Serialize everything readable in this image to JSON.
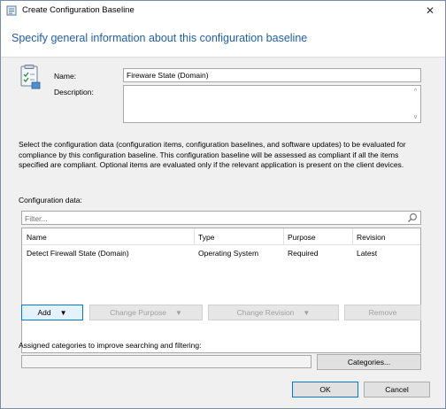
{
  "window": {
    "title": "Create Configuration Baseline",
    "close_glyph": "✕"
  },
  "heading": "Specify general information about this configuration baseline",
  "form": {
    "name_label": "Name:",
    "name_value": "Fireware State (Domain)",
    "description_label": "Description:",
    "description_value": ""
  },
  "instructions": [
    "Select the configuration data (configuration items, configuration baselines, and software updates) to be evaluated for",
    "compliance by this configuration baseline. This configuration baseline will be assessed as compliant if all the items",
    "specified are compliant. Optional items are evaluated only if the relevant application is present on  the client devices."
  ],
  "config_data": {
    "label": "Configuration data:",
    "filter_placeholder": "Filter...",
    "columns": [
      "Name",
      "Type",
      "Purpose",
      "Revision"
    ],
    "rows": [
      [
        "Detect Firewall State (Domain)",
        "Operating System",
        "Required",
        "Latest"
      ]
    ]
  },
  "buttons": {
    "add": "Add",
    "change_purpose": "Change Purpose",
    "change_revision": "Change Revision",
    "remove": "Remove",
    "categories": "Categories...",
    "ok": "OK",
    "cancel": "Cancel"
  },
  "categories": {
    "label": "Assigned categories to improve searching and filtering:",
    "value": ""
  },
  "icons": {
    "title": "baseline-icon",
    "form": "baseline-checklist-icon",
    "search": "search-icon",
    "dropdown": "caret-down-icon"
  },
  "colors": {
    "heading": "#1f5fa8",
    "focus_border": "#0078d7"
  }
}
